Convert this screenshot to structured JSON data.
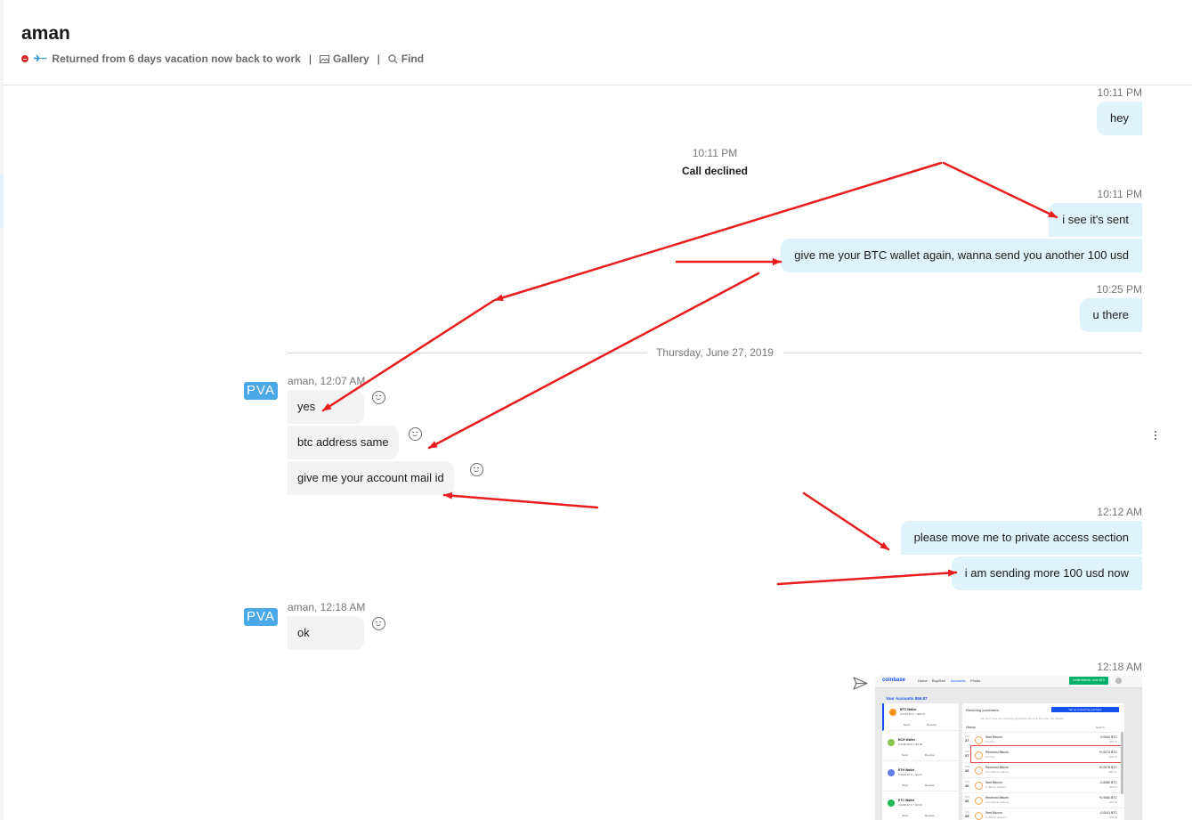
{
  "header": {
    "title": "aman",
    "status_text": "Returned from 6 days vacation now back to work",
    "gallery_label": "Gallery",
    "find_label": "Find"
  },
  "messages": {
    "m1": {
      "time": "10:11 PM",
      "text": "hey"
    },
    "call": {
      "time": "10:11 PM",
      "text": "Call declined"
    },
    "m2": {
      "time": "10:11 PM",
      "text": "i see it's sent"
    },
    "m3": {
      "text": "give me your BTC wallet again, wanna send you another 100 usd"
    },
    "m4": {
      "time": "10:25 PM",
      "text": "u there"
    },
    "day_divider": "Thursday, June 27, 2019",
    "in1": {
      "sender": "aman, 12:07 AM",
      "avatar": "PVA",
      "text": "yes"
    },
    "in2": {
      "text": "btc address same"
    },
    "in3": {
      "text": "give me your account mail id"
    },
    "m5": {
      "time": "12:12 AM",
      "text": "please move me to private access section"
    },
    "m6": {
      "text": "i am sending more 100 usd now"
    },
    "in4": {
      "sender": "aman, 12:18 AM",
      "avatar": "PVA",
      "text": "ok"
    },
    "m7": {
      "time": "12:18 AM"
    }
  },
  "screenshot": {
    "brand": "coinbase",
    "nav": [
      "Home",
      "Buy/Sell",
      "Accounts",
      "Prices"
    ],
    "cta": "Invite friends, earn $10",
    "accounts_title": "Your Accounts $56.87",
    "wallets": [
      {
        "name": "BTC Wallet",
        "balance": "0.0043 BTC ≈ $56.87",
        "color": "#f7931a"
      },
      {
        "name": "BCH Wallet",
        "balance": "0.0000 BCH ≈ $0.00",
        "color": "#8dc351"
      },
      {
        "name": "ETH Wallet",
        "balance": "0.0000 ETH ≈ $0.00",
        "color": "#627eea"
      },
      {
        "name": "ETC Wallet",
        "balance": "0.0000 ETC ≈ $0.00",
        "color": "#1db954"
      }
    ],
    "send_label": "Send",
    "receive_label": "Receive",
    "recurring_title": "Recurring purchases",
    "recurring_btn": "Set up a recurring purchase",
    "recurring_note": "You don't have any recurring purchases set up at this time. Get Started",
    "history_label": "History",
    "search_label": "Search",
    "transactions": [
      {
        "month": "JUN",
        "day": "27",
        "name": "Sent Bitcoin",
        "sub": "Pending",
        "amount": "-0.0040 BTC",
        "usd": "-$56.67"
      },
      {
        "month": "JUN",
        "day": "27",
        "name": "Received Bitcoin",
        "sub": "Pending",
        "amount": "+0.0074 BTC",
        "usd": "+$90.63"
      },
      {
        "month": "JUN",
        "day": "26",
        "name": "Received Bitcoin",
        "sub": "From Bitcoin address",
        "amount": "+0.0078 BTC",
        "usd": "+$80.14"
      },
      {
        "month": "JUN",
        "day": "26",
        "name": "Sent Bitcoin",
        "sub": "To Bitcoin address",
        "amount": "-0.0080 BTC",
        "usd": "-$81.19"
      },
      {
        "month": "JUN",
        "day": "26",
        "name": "Received Bitcoin",
        "sub": "From Bitcoin address",
        "amount": "+0.0084 BTC",
        "usd": "+$85.09"
      },
      {
        "month": "JUN",
        "day": "25",
        "name": "Sent Bitcoin",
        "sub": "To Bitcoin address",
        "amount": "-0.0041 BTC",
        "usd": "-$40.06"
      }
    ]
  },
  "colors": {
    "outgoing_bubble": "#dff3fd",
    "incoming_bubble": "#f3f3f3",
    "annotation_arrow": "#e81d1d",
    "avatar": "#4aa7e8"
  }
}
